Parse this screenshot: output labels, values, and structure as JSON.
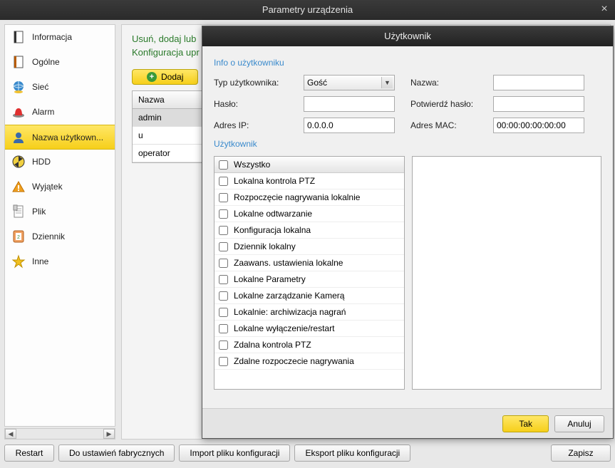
{
  "window": {
    "title": "Parametry urządzenia"
  },
  "sidebar": {
    "items": [
      {
        "label": "Informacja"
      },
      {
        "label": "Ogólne"
      },
      {
        "label": "Sieć"
      },
      {
        "label": "Alarm"
      },
      {
        "label": "Nazwa użytkown..."
      },
      {
        "label": "HDD"
      },
      {
        "label": "Wyjątek"
      },
      {
        "label": "Plik"
      },
      {
        "label": "Dziennik"
      },
      {
        "label": "Inne"
      }
    ]
  },
  "content": {
    "hint1": "Usuń, dodaj lub",
    "hint2": "Konfiguracja upr",
    "add_label": "Dodaj",
    "table_header": "Nazwa",
    "rows": [
      "admin",
      "u",
      "operator"
    ]
  },
  "footer": {
    "restart": "Restart",
    "factory": "Do ustawień fabrycznych",
    "import": "Import pliku konfiguracji",
    "export": "Eksport pliku konfiguracji",
    "save": "Zapisz"
  },
  "modal": {
    "title": "Użytkownik",
    "section_info": "Info o użytkowniku",
    "section_user": "Użytkownik",
    "labels": {
      "user_type": "Typ użytkownika:",
      "name": "Nazwa:",
      "password": "Hasło:",
      "confirm": "Potwierdź hasło:",
      "ip": "Adres IP:",
      "mac": "Adres MAC:"
    },
    "values": {
      "user_type": "Gość",
      "name": "",
      "password": "",
      "confirm": "",
      "ip": "0.0.0.0",
      "mac": "00:00:00:00:00:00"
    },
    "permissions": [
      "Wszystko",
      "Lokalna kontrola PTZ",
      "Rozpoczęcie nagrywania lokalnie",
      "Lokalne odtwarzanie",
      "Konfiguracja lokalna",
      "Dziennik lokalny",
      "Zaawans. ustawienia lokalne",
      "Lokalne Parametry",
      "Lokalne zarządzanie Kamerą",
      "Lokalnie: archiwizacja nagrań",
      "Lokalne wyłączenie/restart",
      "Zdalna kontrola PTZ",
      "Zdalne rozpoczecie nagrywania"
    ],
    "ok": "Tak",
    "cancel": "Anuluj"
  }
}
